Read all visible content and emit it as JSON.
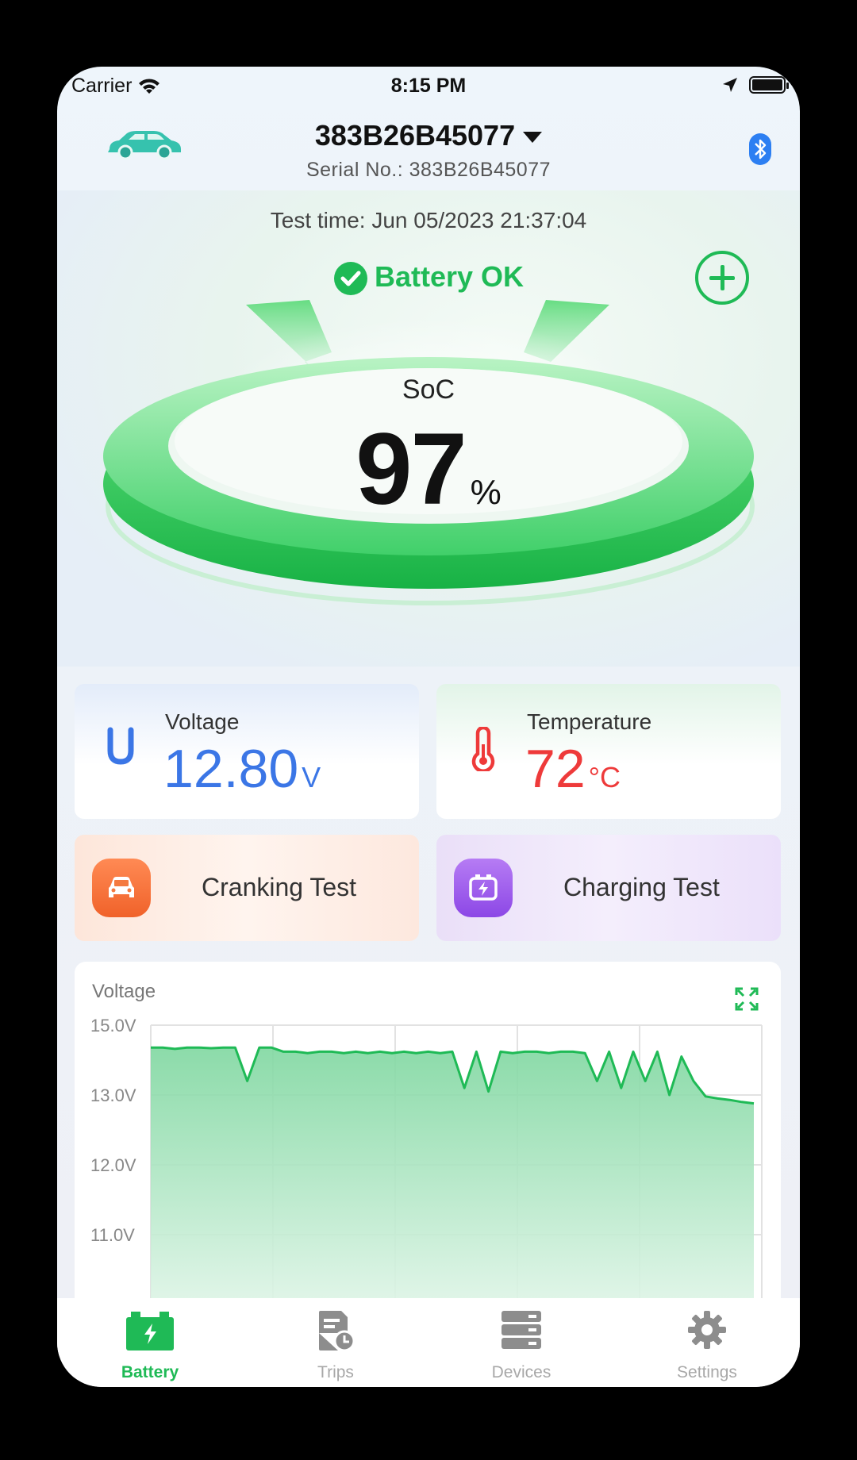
{
  "status_bar": {
    "carrier": "Carrier",
    "time": "8:15 PM"
  },
  "header": {
    "device_name": "383B26B45077",
    "serial": "Serial No.: 383B26B45077"
  },
  "hero": {
    "test_time": "Test time: Jun 05/2023 21:37:04",
    "status_text": "Battery OK",
    "soc_label": "SoC",
    "soc_value": "97",
    "soc_unit": "%"
  },
  "metrics": {
    "voltage": {
      "label": "Voltage",
      "value": "12.80",
      "unit": "V"
    },
    "temperature": {
      "label": "Temperature",
      "value": "72",
      "unit": "°C"
    }
  },
  "tests": {
    "cranking": "Cranking Test",
    "charging": "Charging Test"
  },
  "chart": {
    "title": "Voltage",
    "y_ticks": [
      "15.0V",
      "13.0V",
      "12.0V",
      "11.0V"
    ]
  },
  "chart_data": {
    "type": "area",
    "title": "Voltage",
    "y_tick_labels": [
      "15.0V",
      "13.0V",
      "12.0V",
      "11.0V"
    ],
    "x": [
      0,
      1,
      2,
      3,
      4,
      5,
      6,
      7,
      8,
      9,
      10,
      11,
      12,
      13,
      14,
      15,
      16,
      17,
      18,
      19,
      20,
      21,
      22,
      23,
      24,
      25,
      26,
      27,
      28,
      29,
      30,
      31,
      32,
      33,
      34,
      35,
      36,
      37,
      38,
      39,
      40,
      41,
      42,
      43,
      44,
      45,
      46,
      47,
      48,
      49,
      50
    ],
    "values": [
      13.68,
      13.68,
      13.66,
      13.68,
      13.68,
      13.67,
      13.68,
      13.68,
      13.2,
      13.68,
      13.68,
      13.62,
      13.62,
      13.6,
      13.62,
      13.62,
      13.6,
      13.62,
      13.6,
      13.62,
      13.6,
      13.62,
      13.6,
      13.62,
      13.6,
      13.62,
      13.1,
      13.62,
      13.05,
      13.62,
      13.6,
      13.62,
      13.62,
      13.6,
      13.62,
      13.62,
      13.6,
      13.2,
      13.62,
      13.1,
      13.62,
      13.2,
      13.62,
      13.0,
      13.55,
      13.2,
      12.98,
      12.95,
      12.93,
      12.9,
      12.88
    ],
    "colors": {
      "line": "#1fba56",
      "fill_top": "#7fd7a0",
      "fill_bottom": "#e3f6ea"
    }
  },
  "tabbar": {
    "tabs": [
      {
        "label": "Battery",
        "active": true
      },
      {
        "label": "Trips",
        "active": false
      },
      {
        "label": "Devices",
        "active": false
      },
      {
        "label": "Settings",
        "active": false
      }
    ]
  },
  "colors": {
    "accent": "#1fba56",
    "voltage": "#3b76e6",
    "temperature": "#ee3a3a"
  }
}
